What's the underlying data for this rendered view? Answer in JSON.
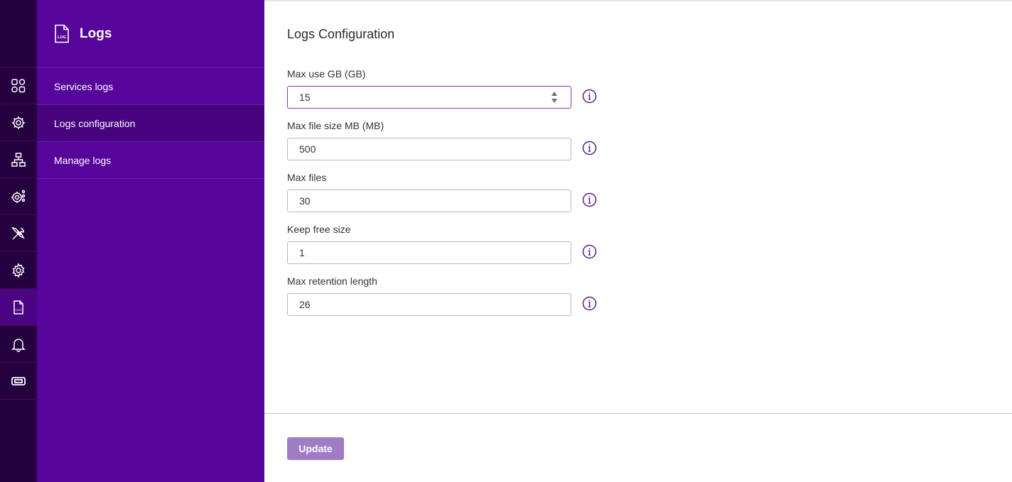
{
  "sidebar": {
    "title": "Logs",
    "items": [
      {
        "label": "Services logs"
      },
      {
        "label": "Logs configuration",
        "active": true
      },
      {
        "label": "Manage logs"
      }
    ]
  },
  "rail": {
    "icons": [
      "dashboard-icon",
      "settings-network-icon",
      "network-topology-icon",
      "advanced-settings-icon",
      "tools-icon",
      "gear-icon",
      "log-file-icon",
      "bell-icon",
      "ticket-icon"
    ],
    "active": "log-file-icon"
  },
  "main": {
    "title": "Logs Configuration",
    "fields": [
      {
        "label": "Max use GB (GB)",
        "value": "15"
      },
      {
        "label": "Max file size MB (MB)",
        "value": "500"
      },
      {
        "label": "Max files",
        "value": "30"
      },
      {
        "label": "Keep free size",
        "value": "1"
      },
      {
        "label": "Max retention length",
        "value": "26"
      }
    ],
    "update_label": "Update"
  },
  "colors": {
    "rail_bg": "#25003f",
    "sidebar_bg": "#56049a",
    "active_item_bg": "#47037e",
    "accent": "#8a2fc4",
    "button_disabled": "#a07cc7",
    "info_icon": "#5a1a8c"
  }
}
